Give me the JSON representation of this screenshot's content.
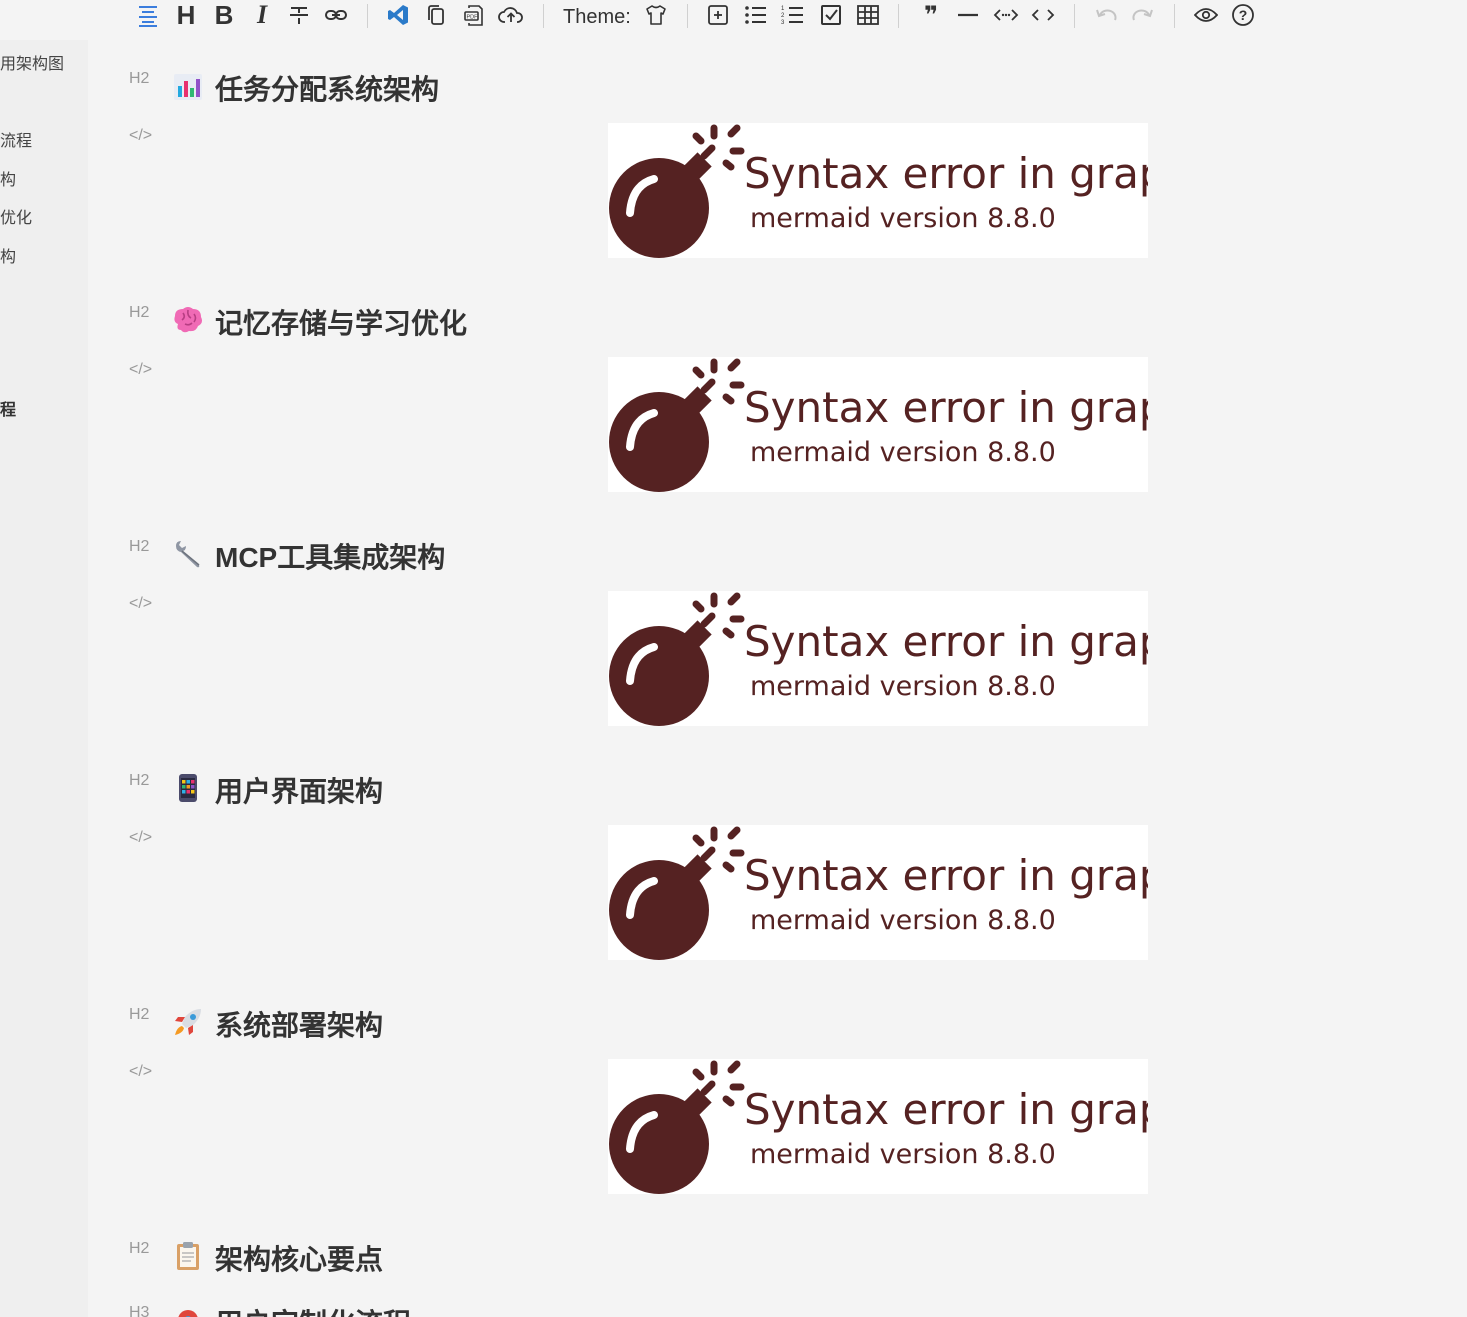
{
  "toolbar": {
    "theme_label": "Theme:"
  },
  "sidebar": {
    "items": [
      {
        "label": "用架构图"
      },
      {
        "label": "流程"
      },
      {
        "label": "构"
      },
      {
        "label": "优化"
      },
      {
        "label": "构"
      },
      {
        "label": "程"
      }
    ]
  },
  "sections": [
    {
      "tag": "H2",
      "emoji": "bar-chart-icon",
      "title": "任务分配系统架构",
      "code_tag": "</>",
      "error_title": "Syntax error in graph",
      "error_version": "mermaid version 8.8.0"
    },
    {
      "tag": "H2",
      "emoji": "brain-icon",
      "title": "记忆存储与学习优化",
      "code_tag": "</>",
      "error_title": "Syntax error in graph",
      "error_version": "mermaid version 8.8.0"
    },
    {
      "tag": "H2",
      "emoji": "wrench-icon",
      "title": "MCP工具集成架构",
      "code_tag": "</>",
      "error_title": "Syntax error in graph",
      "error_version": "mermaid version 8.8.0"
    },
    {
      "tag": "H2",
      "emoji": "phone-icon",
      "title": "用户界面架构",
      "code_tag": "</>",
      "error_title": "Syntax error in graph",
      "error_version": "mermaid version 8.8.0"
    },
    {
      "tag": "H2",
      "emoji": "rocket-icon",
      "title": "系统部署架构",
      "code_tag": "</>",
      "error_title": "Syntax error in graph",
      "error_version": "mermaid version 8.8.0"
    }
  ],
  "final_heading": {
    "tag": "H2",
    "emoji": "clipboard-icon",
    "title": "架构核心要点"
  },
  "partial_heading": {
    "tag": "H3",
    "title": "用户定制化流程"
  },
  "colors": {
    "accent": "#3b7ddd",
    "error_text": "#552222",
    "bomb": "#552222",
    "background": "#f4f4f4"
  }
}
